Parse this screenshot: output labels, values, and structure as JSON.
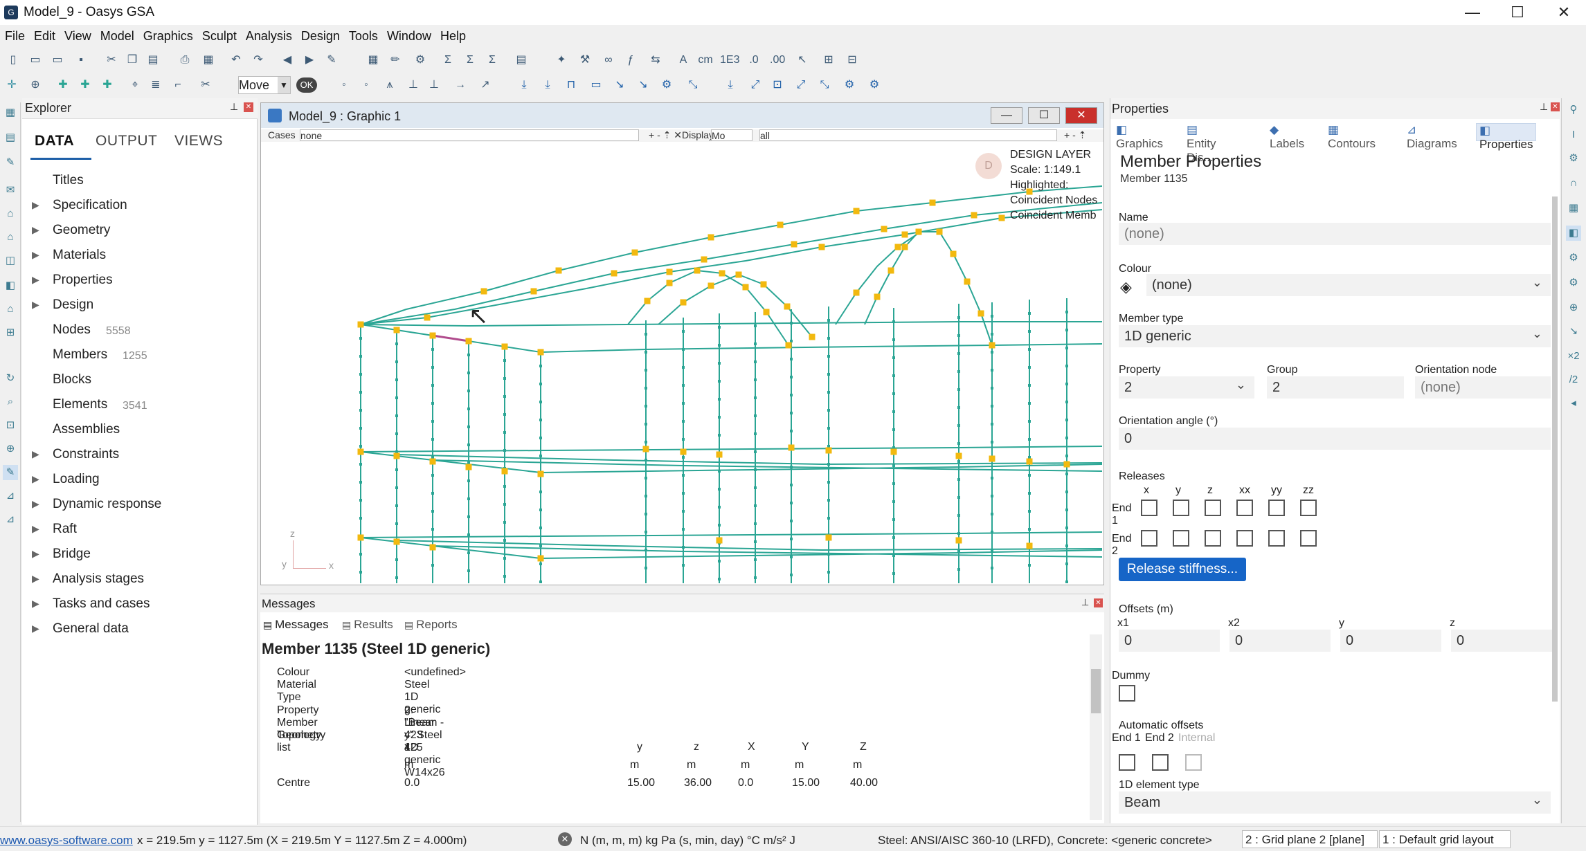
{
  "window": {
    "title": "Model_9 - Oasys GSA",
    "minimize": "—",
    "maximize": "☐",
    "close": "✕"
  },
  "menu": [
    "File",
    "Edit",
    "View",
    "Model",
    "Graphics",
    "Sculpt",
    "Analysis",
    "Design",
    "Tools",
    "Window",
    "Help"
  ],
  "toolbar": {
    "move_label": "Move",
    "ok_label": "OK"
  },
  "explorer": {
    "title": "Explorer",
    "tabs": [
      "DATA",
      "OUTPUT",
      "VIEWS"
    ],
    "items": [
      {
        "label": "Titles",
        "expandable": false,
        "count": ""
      },
      {
        "label": "Specification",
        "expandable": true,
        "count": ""
      },
      {
        "label": "Geometry",
        "expandable": true,
        "count": ""
      },
      {
        "label": "Materials",
        "expandable": true,
        "count": ""
      },
      {
        "label": "Properties",
        "expandable": true,
        "count": ""
      },
      {
        "label": "Design",
        "expandable": true,
        "count": ""
      },
      {
        "label": "Nodes",
        "expandable": false,
        "count": "5558"
      },
      {
        "label": "Members",
        "expandable": false,
        "count": "1255"
      },
      {
        "label": "Blocks",
        "expandable": false,
        "count": ""
      },
      {
        "label": "Elements",
        "expandable": false,
        "count": "3541"
      },
      {
        "label": "Assemblies",
        "expandable": false,
        "count": ""
      },
      {
        "label": "Constraints",
        "expandable": true,
        "count": ""
      },
      {
        "label": "Loading",
        "expandable": true,
        "count": ""
      },
      {
        "label": "Dynamic response",
        "expandable": true,
        "count": ""
      },
      {
        "label": "Raft",
        "expandable": true,
        "count": ""
      },
      {
        "label": "Bridge",
        "expandable": true,
        "count": ""
      },
      {
        "label": "Analysis stages",
        "expandable": true,
        "count": ""
      },
      {
        "label": "Tasks and cases",
        "expandable": true,
        "count": ""
      },
      {
        "label": "General data",
        "expandable": true,
        "count": ""
      }
    ]
  },
  "graphic": {
    "title": "Model_9 : Graphic 1",
    "cases_label": "Cases",
    "cases_value": "none",
    "display_label": "Display",
    "display_value": "Mo",
    "filter_value": "all",
    "layer_badge": "D",
    "overlay": [
      "DESIGN LAYER",
      "Scale: 1:149.1",
      "Highlighted:",
      "Coincident Nodes",
      "Coincident Memb"
    ],
    "axis_z": "z",
    "axis_y": "y",
    "axis_x": "x"
  },
  "messages": {
    "title": "Messages",
    "tabs": [
      "Messages",
      "Results",
      "Reports"
    ],
    "heading": "Member 1135 (Steel 1D generic)",
    "rows": [
      {
        "key": "Colour",
        "value": "<undefined>"
      },
      {
        "key": "Material",
        "value": "Steel"
      },
      {
        "key": "Type",
        "value": "1D generic"
      },
      {
        "key": "Property",
        "value": "2: \"Beam - y\" Steel 1D generic W14x26"
      },
      {
        "key": "Member Geometry",
        "value": "Linear"
      },
      {
        "key": "Topology list",
        "value": "423 425"
      }
    ],
    "coord_headers": [
      "x",
      "y",
      "z",
      "X",
      "Y",
      "Z"
    ],
    "coord_units": [
      "m",
      "m",
      "m",
      "m",
      "m",
      "m"
    ],
    "centre_label": "Centre",
    "centre_values": [
      "0.0",
      "15.00",
      "36.00",
      "0.0",
      "15.00",
      "40.00"
    ]
  },
  "properties": {
    "title": "Properties",
    "tabs": [
      "Graphics",
      "Entity Dis...",
      "Labels",
      "Contours",
      "Diagrams",
      "Properties"
    ],
    "heading": "Member Properties",
    "subheading": "Member 1135",
    "name_label": "Name",
    "name_value": "(none)",
    "colour_label": "Colour",
    "colour_value": "(none)",
    "member_type_label": "Member type",
    "member_type_value": "1D generic",
    "property_label": "Property",
    "property_value": "2",
    "group_label": "Group",
    "group_value": "2",
    "orientation_node_label": "Orientation node",
    "orientation_node_value": "(none)",
    "orientation_angle_label": "Orientation angle (°)",
    "orientation_angle_value": "0",
    "releases_label": "Releases",
    "release_cols": [
      "x",
      "y",
      "z",
      "xx",
      "yy",
      "zz"
    ],
    "end1_label": "End 1",
    "end2_label": "End 2",
    "release_button": "Release stiffness...",
    "offsets_label": "Offsets (m)",
    "offset_fields": [
      {
        "label": "x1",
        "value": "0"
      },
      {
        "label": "x2",
        "value": "0"
      },
      {
        "label": "y",
        "value": "0"
      },
      {
        "label": "z",
        "value": "0"
      }
    ],
    "dummy_label": "Dummy",
    "auto_offsets_label": "Automatic offsets",
    "auto_end1": "End 1",
    "auto_end2": "End 2",
    "auto_internal": "Internal",
    "element_type_label": "1D element type",
    "element_type_value": "Beam"
  },
  "status": {
    "link": "www.oasys-software.com",
    "coords": "x = 219.5m   y = 1127.5m   (X = 219.5m   Y = 1127.5m   Z = 4.000m)",
    "units": "N  (m, m, m)  kg  Pa  (s, min, day)  °C  m/s²  J",
    "codes": "Steel: ANSI/AISC 360-10 (LRFD), Concrete: <generic concrete>",
    "grid_plane": "2 : Grid plane 2 [plane]",
    "grid_layout": "1 : Default grid layout"
  },
  "colors": {
    "structure": "#2aa594",
    "node": "#f2b90f",
    "highlight": "#b04a8c",
    "accent": "#1665c7"
  }
}
